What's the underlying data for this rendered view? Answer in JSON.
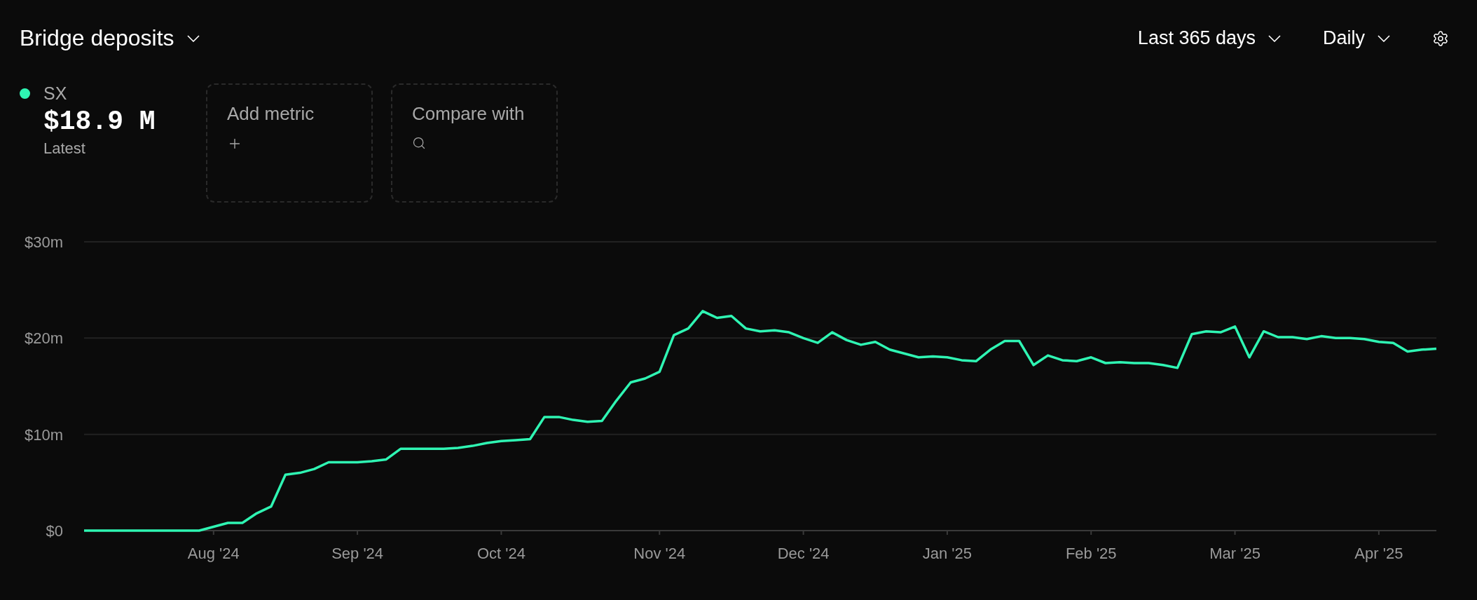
{
  "header": {
    "title": "Bridge deposits",
    "range": "Last 365 days",
    "interval": "Daily"
  },
  "legend": {
    "value": "$18.9 M",
    "caption": "Latest"
  },
  "actions": [
    {
      "kind": "add",
      "label": "Add metric"
    },
    {
      "kind": "search",
      "label": "Compare with"
    }
  ],
  "chart": {
    "chart_data": {
      "type": "line",
      "categories": [
        null,
        null,
        null,
        null,
        null,
        null,
        null,
        null,
        null,
        "Aug '24",
        null,
        null,
        null,
        null,
        null,
        null,
        null,
        null,
        null,
        "Sep '24",
        null,
        null,
        null,
        null,
        null,
        null,
        null,
        null,
        null,
        "Oct '24",
        null,
        null,
        null,
        null,
        null,
        null,
        null,
        null,
        null,
        null,
        "Nov '24",
        null,
        null,
        null,
        null,
        null,
        null,
        null,
        null,
        null,
        "Dec '24",
        null,
        null,
        null,
        null,
        null,
        null,
        null,
        null,
        null,
        "Jan '25",
        null,
        null,
        null,
        null,
        null,
        null,
        null,
        null,
        null,
        "Feb '25",
        null,
        null,
        null,
        null,
        null,
        null,
        null,
        null,
        null,
        "Mar '25",
        null,
        null,
        null,
        null,
        null,
        null,
        null,
        null,
        null,
        "Apr '25",
        null,
        null,
        null,
        null
      ],
      "series": [
        {
          "name": "SX",
          "color": "#2ff5b3",
          "values": [
            0,
            0,
            0,
            0,
            0,
            0,
            0,
            0,
            0,
            0.4,
            0.8,
            0.8,
            1.8,
            2.5,
            5.8,
            6.0,
            6.4,
            7.1,
            7.1,
            7.1,
            7.2,
            7.4,
            8.5,
            8.5,
            8.5,
            8.5,
            8.6,
            8.8,
            9.1,
            9.3,
            9.4,
            9.5,
            11.8,
            11.8,
            11.5,
            11.3,
            11.4,
            13.5,
            15.4,
            15.8,
            16.5,
            20.3,
            21.0,
            22.8,
            22.1,
            22.3,
            21.0,
            20.7,
            20.8,
            20.6,
            20.0,
            19.5,
            20.6,
            19.8,
            19.3,
            19.6,
            18.8,
            18.4,
            18.0,
            18.1,
            18.0,
            17.7,
            17.6,
            18.8,
            19.7,
            19.7,
            17.2,
            18.2,
            17.7,
            17.6,
            18.0,
            17.4,
            17.5,
            17.4,
            17.4,
            17.2,
            16.9,
            20.4,
            20.7,
            20.6,
            21.2,
            18.0,
            20.7,
            20.1,
            20.1,
            19.9,
            20.2,
            20.0,
            20.0,
            19.9,
            19.6,
            19.5,
            18.6,
            18.8,
            18.9
          ]
        }
      ],
      "ylim": [
        0,
        30
      ],
      "yticks": [
        {
          "value": 0,
          "label": "$0"
        },
        {
          "value": 10,
          "label": "$10m"
        },
        {
          "value": 20,
          "label": "$20m"
        },
        {
          "value": 30,
          "label": "$30m"
        }
      ]
    }
  }
}
